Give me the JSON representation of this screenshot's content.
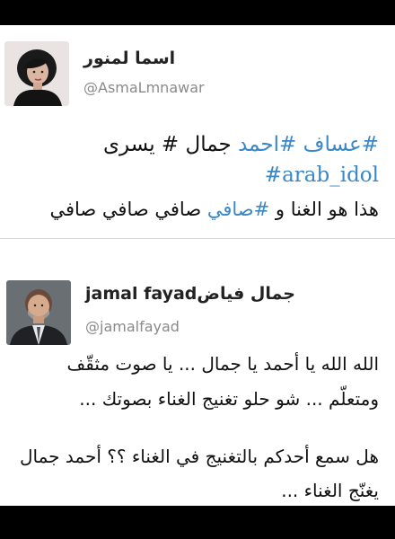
{
  "tweet1": {
    "display_name": "اسما لمنور",
    "handle": "@AsmaLmnawar",
    "line1_hash1": "#عساف",
    "line1_hash2": "#احمد",
    "line1_rest": " جمال # يسرى",
    "line2_hashtag": "#arab_idol",
    "line3_prefix": "هذا هو الغنا و ",
    "line3_hashtag": "#صافي",
    "line3_suffix": " صافي صافي صافي"
  },
  "tweet2": {
    "display_name_en": "jamal fayad",
    "display_name_ar": "جمال فياض",
    "handle": "@jamalfayad",
    "para1_line1": "الله الله يا أحمد يا جمال ... يا صوت مثقّف",
    "para1_line2": "ومتعلّم ... شو حلو تغنيج الغناء بصوتك ...",
    "para2_line1": "هل سمع أحدكم بالتغنيج في الغناء ؟؟ أحمد جمال",
    "para2_line2": "يغنّج الغناء ..."
  },
  "colors": {
    "link": "#3a87c8",
    "handle": "#8a8a8a",
    "frame": "#000000",
    "background": "#ffffff"
  }
}
